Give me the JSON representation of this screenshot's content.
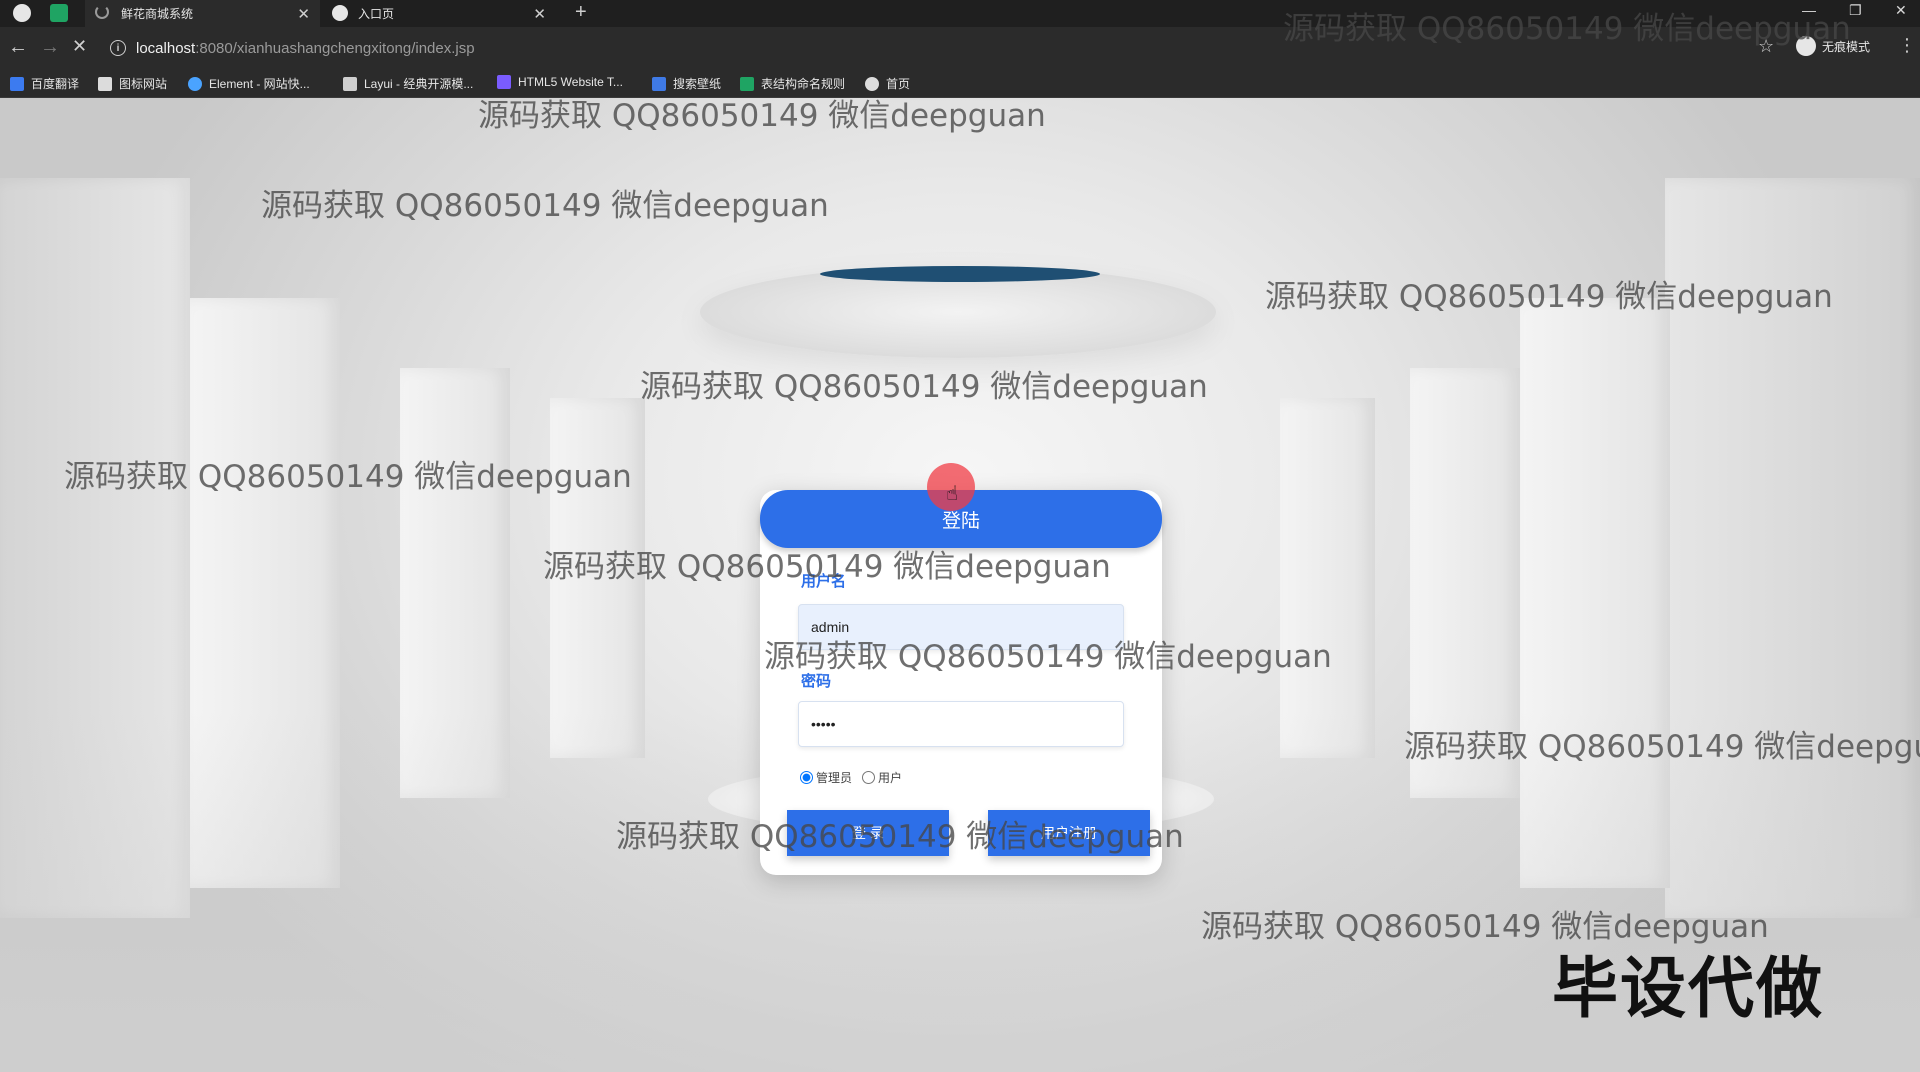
{
  "browser": {
    "tabs": [
      {
        "label": "鲜花商城系统",
        "active": true
      },
      {
        "label": "入口页",
        "active": false
      }
    ],
    "url_host": "localhost",
    "url_path": ":8080/xianhuashangchengxitong/index.jsp",
    "incognito_label": "无痕模式",
    "bookmarks": [
      {
        "label": "百度翻译",
        "color": "#3c7bf0"
      },
      {
        "label": "图标网站",
        "color": "#dcdcdc"
      },
      {
        "label": "Element - 网站快...",
        "color": "#4aa3ff"
      },
      {
        "label": "Layui - 经典开源模...",
        "color": "#cfcfcf"
      },
      {
        "label": "HTML5 Website T...",
        "color": "#7a5cff"
      },
      {
        "label": "搜索壁纸",
        "color": "#3f7ae6"
      },
      {
        "label": "表结构命名规则",
        "color": "#1fa463"
      },
      {
        "label": "首页",
        "color": "#dcdcdc"
      }
    ]
  },
  "login": {
    "title": "登陆",
    "username_label": "用户名",
    "username_value": "admin",
    "password_label": "密码",
    "password_value": "•••••",
    "role_admin": "管理员",
    "role_user": "用户",
    "selected_role": "admin",
    "login_button": "登 录",
    "register_button": "用户注册"
  },
  "watermark": {
    "text": "源码获取 QQ86050149 微信deepguan",
    "text_cut": "源码获取 QQ86050149 微信deepgua"
  },
  "stamp": "毕设代做",
  "colors": {
    "accent": "#2d6fe8",
    "browser_dark": "#2b2b2b"
  }
}
